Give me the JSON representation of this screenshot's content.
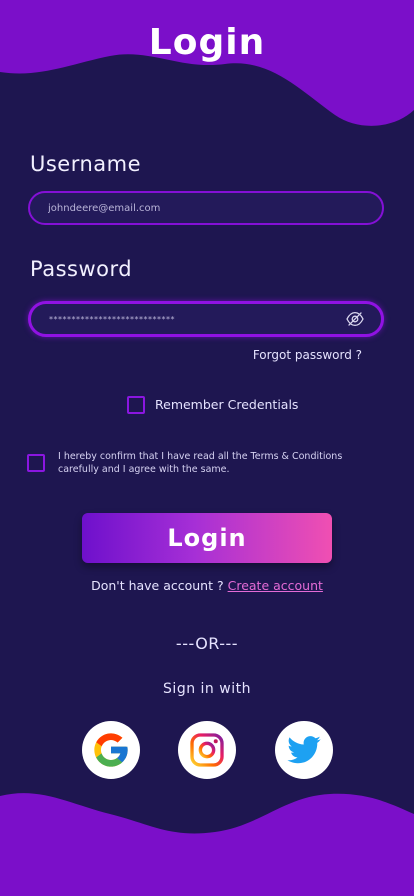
{
  "page": {
    "title": "Login"
  },
  "form": {
    "username_label": "Username",
    "username_value": "johndeere@email.com",
    "password_label": "Password",
    "password_value": "****************************",
    "forgot_password": "Forgot password ?",
    "remember_label": "Remember Credentials",
    "terms_text": "I hereby confirm that I have read all the Terms & Conditions carefully and I agree with the same.",
    "login_label": "Login"
  },
  "signup": {
    "prompt": "Don't have account ?",
    "link": "Create account"
  },
  "social": {
    "divider": "---OR---",
    "heading": "Sign in with",
    "providers": [
      "google-icon",
      "instagram-icon",
      "twitter-icon"
    ]
  },
  "colors": {
    "background": "#1e1650",
    "wave": "#7b0fc9",
    "accent": "#8410d6",
    "button_start": "#6e10cc",
    "button_end": "#f04fb2",
    "link": "#e46bd6"
  }
}
